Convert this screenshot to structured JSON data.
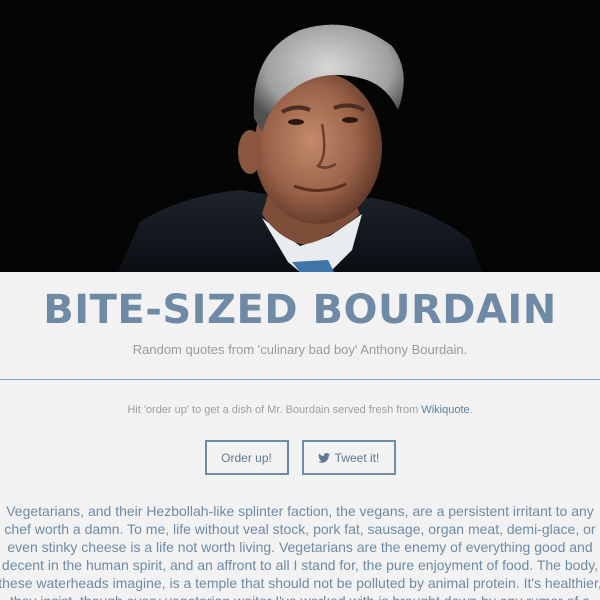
{
  "hero": {
    "image": "portrait-photo",
    "background": "#050505"
  },
  "header": {
    "title": "BITE-SIZED BOURDAIN",
    "subtitle": "Random quotes from 'culinary bad boy' Anthony Bourdain."
  },
  "hint": {
    "text_before": "Hit 'order up' to get a dish of Mr. Bourdain served fresh from ",
    "link_label": "Wikiquote",
    "text_after": "."
  },
  "buttons": {
    "order_label": "Order up!",
    "tweet_label": "Tweet it!",
    "tweet_icon": "twitter-bird-icon"
  },
  "quote": {
    "text": "Vegetarians, and their Hezbollah-like splinter faction, the vegans, are a persistent irritant to any chef worth a damn. To me, life without veal stock, pork fat, sausage, organ meat, demi-glace, or even stinky cheese is a life not worth living. Vegetarians are the enemy of everything good and decent in the human spirit, and an affront to all I stand for, the pure enjoyment of food. The body, these waterheads imagine, is a temple that should not be polluted by animal protein. It's healthier, they insist, though every vegetarian waiter I've worked with is brought down by any rumor of a cold. Oh, I"
  },
  "colors": {
    "accent": "#6f8aa5",
    "page_bg": "#f2f2f3",
    "muted_text": "#9a9a9a",
    "link": "#5d7d9c"
  }
}
